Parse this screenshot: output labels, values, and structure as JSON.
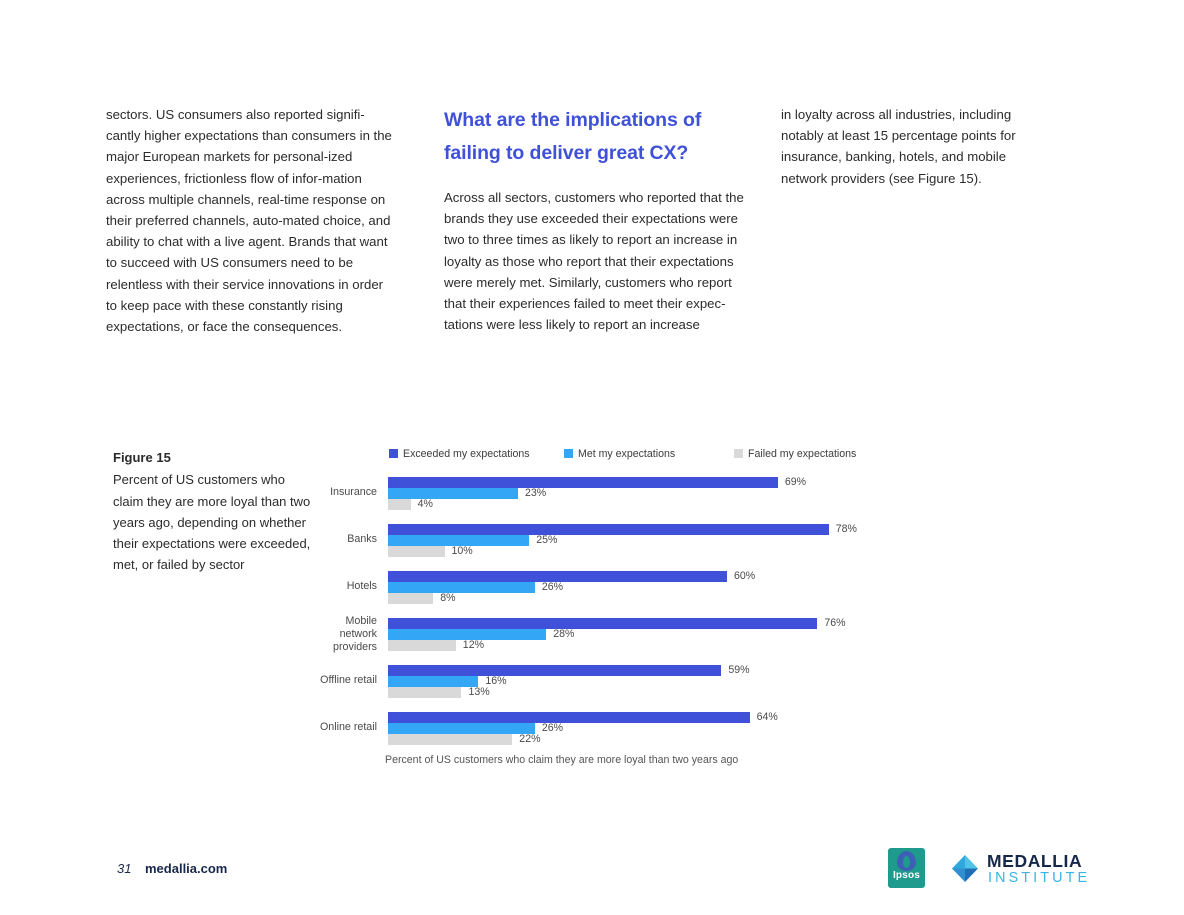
{
  "columns": {
    "left_paragraph": "sectors. US consumers also reported signifi-cantly higher expectations than consumers in the major European markets for personal-ized experiences, frictionless flow of infor-mation across multiple channels, real-time response on their preferred channels, auto-mated choice, and ability to chat with a live agent. Brands that want to succeed with US consumers need to be relentless with their service innovations in order to keep pace with these constantly rising expectations, or face the consequences.",
    "middle_heading": "What are the implications of failing to deliver great CX?",
    "middle_paragraph": "Across all sectors, customers who reported that the brands they use exceeded their expectations were two to three times as likely to report an increase in loyalty as those who report that their expectations were merely met. Similarly, customers who report that their experiences failed to meet their expec-tations were less likely to report an increase",
    "right_paragraph": "in loyalty across all industries, including notably at least 15 percentage points for insurance, banking, hotels, and mobile network providers (see Figure 15)."
  },
  "figure": {
    "title": "Figure 15",
    "caption": "Percent of US customers who claim they are more loyal than two years ago, depending on whether their expectations were exceeded, met, or failed by sector"
  },
  "chart_data": {
    "type": "bar",
    "orientation": "horizontal",
    "title": "Percent of US customers who claim they are more loyal than two years ago, depending on whether their expectations were exceeded, met, or failed by sector",
    "xlabel": "Percent of US customers who claim they are more loyal than two years ago",
    "ylabel": "",
    "xlim": [
      0,
      80
    ],
    "grid": false,
    "legend_position": "top",
    "categories": [
      "Insurance",
      "Banks",
      "Hotels",
      "Mobile network providers",
      "Offline retail",
      "Online retail"
    ],
    "series": [
      {
        "name": "Exceeded my expectations",
        "color": "#3f51d8",
        "values": [
          69,
          78,
          60,
          76,
          59,
          64
        ],
        "labels": [
          "69%",
          "78%",
          "60%",
          "76%",
          "59%",
          "64%"
        ]
      },
      {
        "name": "Met my expectations",
        "color": "#33a7f5",
        "values": [
          23,
          25,
          26,
          28,
          16,
          26
        ],
        "labels": [
          "23%",
          "25%",
          "26%",
          "28%",
          "16%",
          "26%"
        ]
      },
      {
        "name": "Failed my expectations",
        "color": "#d9d9d9",
        "values": [
          4,
          10,
          8,
          12,
          13,
          22
        ],
        "labels": [
          "4%",
          "10%",
          "8%",
          "12%",
          "13%",
          "22%"
        ]
      }
    ]
  },
  "footer": {
    "page_number": "31",
    "site": "medallia.com",
    "ipsos_logo_text": "Ipsos",
    "medallia_wordmark": "MEDALLIA",
    "medallia_subtitle": "INSTITUTE"
  },
  "colors": {
    "heading_blue": "#3f51d8",
    "exceeded": "#3f51d8",
    "met": "#33a7f5",
    "failed": "#d9d9d9",
    "footer_navy": "#16284a",
    "institute_cyan": "#36b4e5"
  }
}
